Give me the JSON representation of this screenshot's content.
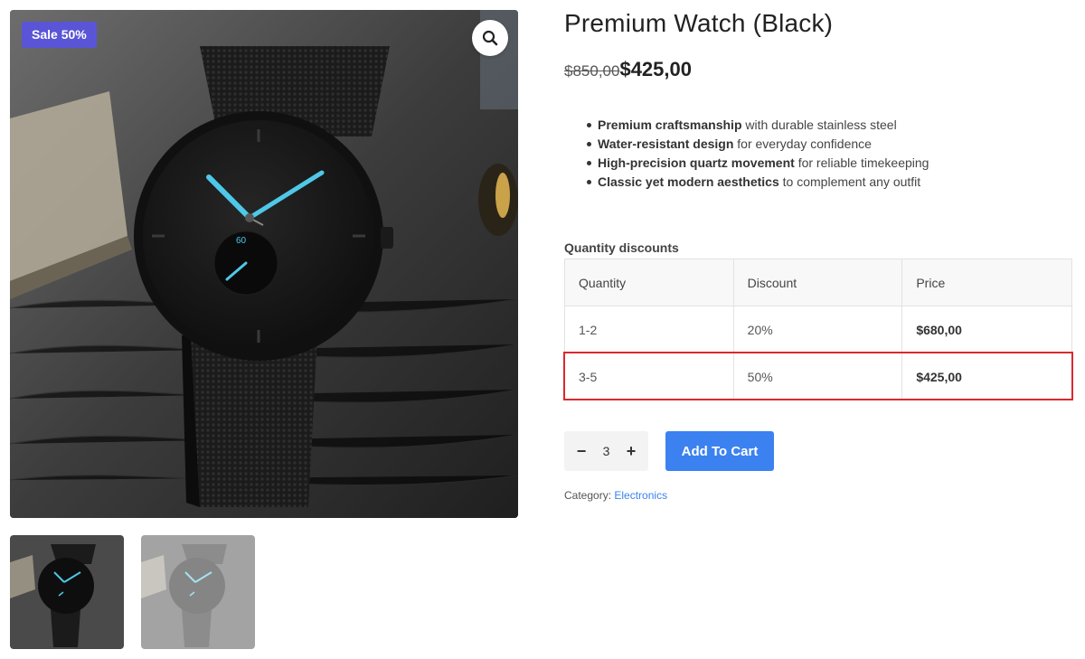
{
  "gallery": {
    "badge": "Sale 50%",
    "zoom_icon": "magnifier-icon",
    "dial_text": "60"
  },
  "product": {
    "title": "Premium Watch (Black)",
    "price_old": "$850,00",
    "price_new": "$425,00",
    "features": [
      {
        "bold": "Premium craftsmanship",
        "rest": " with durable stainless steel"
      },
      {
        "bold": "Water-resistant design",
        "rest": " for everyday confidence"
      },
      {
        "bold": "High-precision quartz movement",
        "rest": " for reliable timekeeping"
      },
      {
        "bold": "Classic yet modern aesthetics",
        "rest": " to complement any outfit"
      }
    ]
  },
  "discounts": {
    "label": "Quantity discounts",
    "headers": [
      "Quantity",
      "Discount",
      "Price"
    ],
    "rows": [
      [
        "1-2",
        "20%",
        "$680,00"
      ],
      [
        "3-5",
        "50%",
        "$425,00"
      ]
    ]
  },
  "cart": {
    "minus": "−",
    "quantity": "3",
    "plus": "+",
    "add_label": "Add To Cart"
  },
  "meta": {
    "category_label": "Category:",
    "category_link": "Electronics"
  },
  "colors": {
    "badge": "#5a55d6",
    "accent": "#3b82f0",
    "highlight": "#d9282f",
    "hands": "#4fc8e8"
  }
}
